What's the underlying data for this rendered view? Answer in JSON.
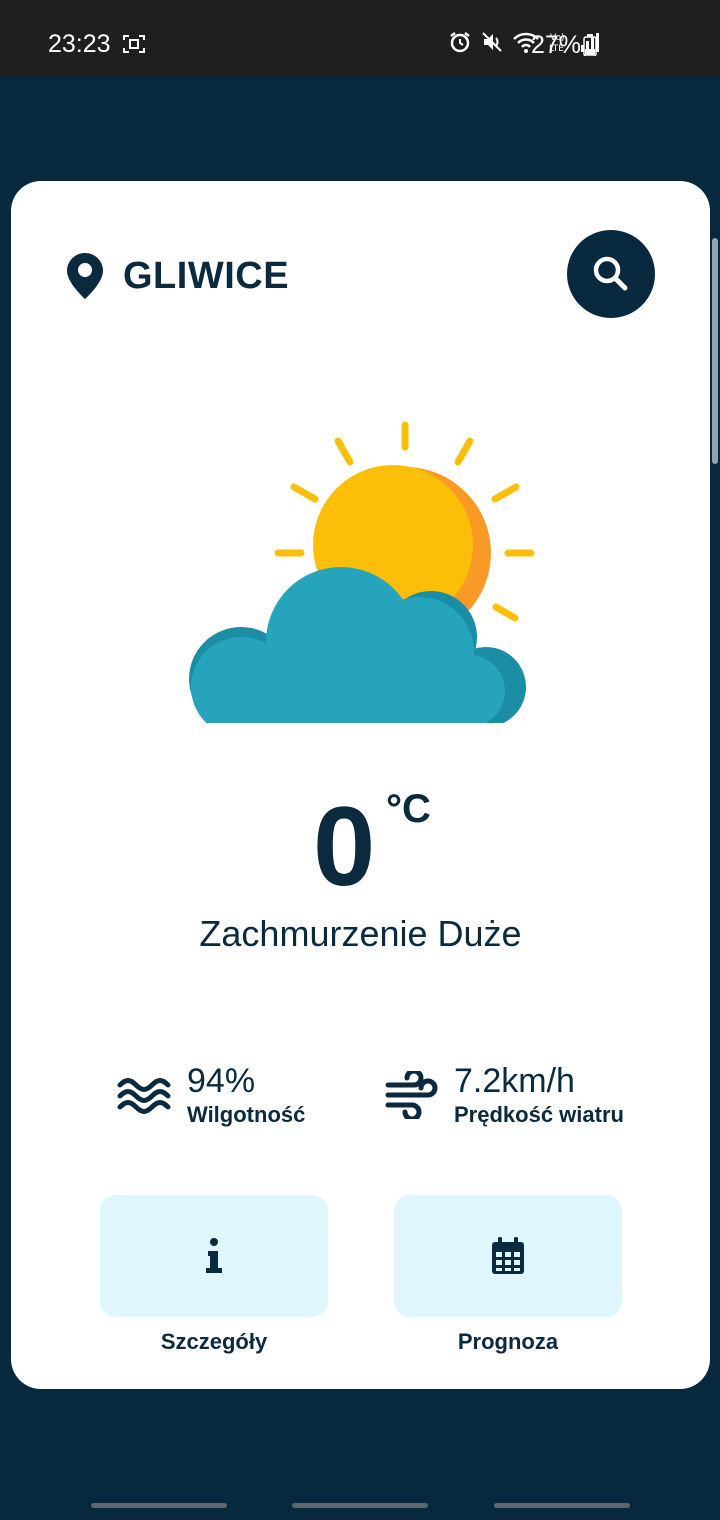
{
  "status_bar": {
    "time": "23:23",
    "battery": "27%",
    "icons": [
      "screenshot-icon",
      "alarm-icon",
      "mute-icon",
      "wifi-icon",
      "volte-icon",
      "signal-icon",
      "battery-icon"
    ]
  },
  "location": {
    "city": "GLIWICE",
    "icon": "location-pin-icon"
  },
  "search": {
    "icon": "search-icon"
  },
  "weather": {
    "icon": "partly-cloudy-sun-icon",
    "temperature": "0",
    "unit": "°C",
    "condition": "Zachmurzenie Duże"
  },
  "stats": {
    "humidity": {
      "value": "94%",
      "label": "Wilgotność",
      "icon": "waves-icon"
    },
    "wind": {
      "value": "7.2km/h",
      "label": "Prędkość wiatru",
      "icon": "wind-icon"
    }
  },
  "actions": {
    "details": {
      "label": "Szczegóły",
      "icon": "info-icon"
    },
    "forecast": {
      "label": "Prognoza",
      "icon": "calendar-icon"
    }
  },
  "colors": {
    "background": "#08283d",
    "card": "#ffffff",
    "text": "#0b2a3e",
    "tile": "#dff6fc",
    "sun": "#fbbf0a",
    "cloud": "#26a4bc"
  }
}
